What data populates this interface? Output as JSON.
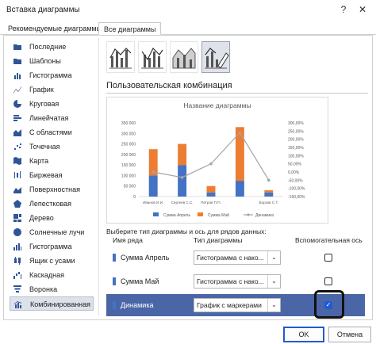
{
  "window": {
    "title": "Вставка диаграммы",
    "help_icon": "?",
    "close_icon": "✕"
  },
  "tabs": [
    {
      "label": "Рекомендуемые диаграммы"
    },
    {
      "label": "Все диаграммы"
    }
  ],
  "sidebar": {
    "items": [
      {
        "label": "Последние",
        "icon": "folder-icon"
      },
      {
        "label": "Шаблоны",
        "icon": "folder-icon"
      },
      {
        "label": "Гистограмма",
        "icon": "column-chart-icon"
      },
      {
        "label": "График",
        "icon": "line-chart-icon"
      },
      {
        "label": "Круговая",
        "icon": "pie-chart-icon"
      },
      {
        "label": "Линейчатая",
        "icon": "bar-chart-icon"
      },
      {
        "label": "С областями",
        "icon": "area-chart-icon"
      },
      {
        "label": "Точечная",
        "icon": "scatter-chart-icon"
      },
      {
        "label": "Карта",
        "icon": "map-chart-icon"
      },
      {
        "label": "Биржевая",
        "icon": "stock-chart-icon"
      },
      {
        "label": "Поверхностная",
        "icon": "surface-chart-icon"
      },
      {
        "label": "Лепестковая",
        "icon": "radar-chart-icon"
      },
      {
        "label": "Дерево",
        "icon": "treemap-chart-icon"
      },
      {
        "label": "Солнечные лучи",
        "icon": "sunburst-chart-icon"
      },
      {
        "label": "Гистограмма",
        "icon": "histogram-chart-icon"
      },
      {
        "label": "Ящик с усами",
        "icon": "box-whisker-chart-icon"
      },
      {
        "label": "Каскадная",
        "icon": "waterfall-chart-icon"
      },
      {
        "label": "Воронка",
        "icon": "funnel-chart-icon"
      },
      {
        "label": "Комбинированная",
        "icon": "combo-chart-icon"
      }
    ],
    "selected_index": 18
  },
  "chart_types": [
    {
      "icon": "combo-clustered-column-line-icon"
    },
    {
      "icon": "combo-column-line-secondary-icon"
    },
    {
      "icon": "combo-stacked-area-column-icon"
    },
    {
      "icon": "custom-combination-icon"
    }
  ],
  "section_title": "Пользовательская комбинация",
  "chart_data": {
    "type": "bar",
    "title": "Название диаграммы",
    "categories": [
      "Иванов И.И.",
      "Сергеев С.С.",
      "Петров П.П.",
      "Борзов С.Т."
    ],
    "series": [
      {
        "name": "Сумма Апрель",
        "type": "stacked-bar",
        "values": [
          100000,
          150000,
          20000,
          75000,
          20000
        ],
        "color": "#4472c4"
      },
      {
        "name": "Сумма Май",
        "type": "stacked-bar",
        "values": [
          125000,
          100000,
          30000,
          255000,
          10000
        ],
        "color": "#ed7d31"
      },
      {
        "name": "Динамика",
        "type": "line",
        "axis": "secondary",
        "values": [
          0.0,
          -0.33,
          0.5,
          2.4,
          -0.5
        ],
        "color": "#a5a5a5"
      }
    ],
    "category_labels_shown": [
      "Иванов И.И.",
      "Сергеев С.С.",
      "Петров П.П.",
      "Борзов С.Т."
    ],
    "ylim": [
      0,
      350000
    ],
    "y_ticks": [
      "350 000",
      "300 000",
      "250 000",
      "200 000",
      "150 000",
      "100 000",
      "50 000",
      "0"
    ],
    "y2lim": [
      -1.5,
      3.0
    ],
    "y2_ticks": [
      "300,00%",
      "250,00%",
      "200,00%",
      "150,00%",
      "100,00%",
      "50,00%",
      "0,00%",
      "-50,00%",
      "-100,00%",
      "-150,00%"
    ],
    "legend_position": "bottom",
    "grid": false
  },
  "series_select_label": "Выберите тип диаграммы и ось для рядов данных:",
  "grid": {
    "headers": {
      "name": "Имя ряда",
      "type": "Тип диаграммы",
      "axis": "Вспомогательная ось"
    },
    "rows": [
      {
        "name": "Сумма Апрель",
        "type": "Гистограмма с нако...",
        "secondary": false,
        "color": "#4472c4"
      },
      {
        "name": "Сумма Май",
        "type": "Гистограмма с нако...",
        "secondary": false,
        "color": "#4472c4"
      },
      {
        "name": "Динамика",
        "type": "График с маркерами",
        "secondary": true,
        "color": "#4472c4"
      }
    ],
    "selected_index": 2
  },
  "buttons": {
    "ok": "OK",
    "cancel": "Отмена"
  }
}
